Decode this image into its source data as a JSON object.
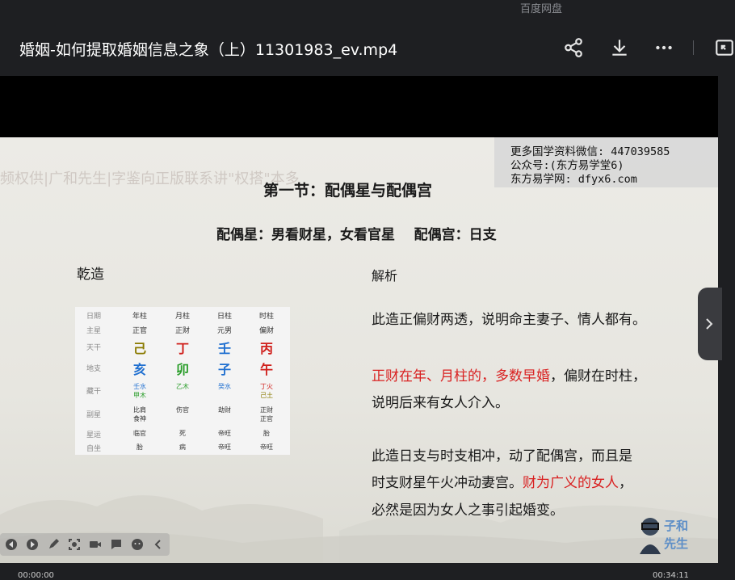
{
  "app": {
    "name": "百度网盘",
    "file_title": "婚姻-如何提取婚姻信息之象（上）11301983_ev.mp4"
  },
  "toolbar": {
    "icons": [
      "share-icon",
      "download-icon",
      "more-icon",
      "picture-in-picture-icon"
    ]
  },
  "slide": {
    "watermark_faded": "频权供|广和先生|字鉴向正版联系讲\"权搭\"本多",
    "watermark_box": [
      "更多国学资料微信: 447039585",
      "公众号:(东方易学堂6)",
      "东方易学网: dfyx6.com"
    ],
    "title": "第一节：配偶星与配偶宫",
    "subtitle": "配偶星：男看财星，女看官星    配偶宫：日支",
    "left_heading": "乾造",
    "right_heading": "解析",
    "bazi": {
      "header": [
        "日期",
        "年柱",
        "月柱",
        "日柱",
        "时柱"
      ],
      "zhuxing": [
        "主星",
        "正官",
        "正财",
        "元男",
        "偏财"
      ],
      "tiangan": {
        "label": "天干",
        "values": [
          "己",
          "丁",
          "壬",
          "丙"
        ],
        "colors": [
          "#8a7a00",
          "#d0201c",
          "#1f6fd0",
          "#d0201c"
        ]
      },
      "dizhi": {
        "label": "地支",
        "values": [
          "亥",
          "卯",
          "子",
          "午"
        ],
        "colors": [
          "#1f6fd0",
          "#2a9d2a",
          "#1f6fd0",
          "#d0201c"
        ]
      },
      "canggan": {
        "label": "藏干",
        "values": [
          [
            "壬水",
            "甲木"
          ],
          [
            "乙木"
          ],
          [
            "癸水"
          ],
          [
            "丁火",
            "己土"
          ]
        ]
      },
      "fuxing": {
        "label": "副星",
        "values": [
          [
            "比肩",
            "食神"
          ],
          [
            "伤官"
          ],
          [
            "劫财"
          ],
          [
            "正财",
            "正官"
          ]
        ]
      },
      "xingyun": {
        "label": "星运",
        "values": [
          "临官",
          "死",
          "帝旺",
          "胎"
        ]
      },
      "zizuo": {
        "label": "自坐",
        "values": [
          "胎",
          "病",
          "帝旺",
          "帝旺"
        ]
      }
    },
    "analysis": {
      "p1": "此造正偏财两透，说明命主妻子、情人都有。",
      "p2_red": "正财在年、月柱的，多数早婚",
      "p2_rest": "，偏财在时柱，",
      "p2_line2": "说明后来有女人介入。",
      "p3_line1": "此造日支与时支相冲，动了配偶宫，而且是",
      "p3_line2_a": "时支财星午火冲动妻宫。",
      "p3_line2_red": "财为广义的女人",
      "p3_line2_b": "，",
      "p3_line3": "必然是因为女人之事引起婚变。"
    },
    "logo_text": [
      "子和",
      "先生"
    ]
  },
  "player": {
    "controls": [
      "prev-icon",
      "next-icon",
      "pen-icon",
      "screenshot-icon",
      "camera-icon",
      "comment-icon",
      "emoji-icon",
      "collapse-icon"
    ],
    "time_left": "00:00:00",
    "time_right": "00:34:11"
  },
  "colors": {
    "accent_red": "#d92020",
    "background": "#1e1f22"
  }
}
